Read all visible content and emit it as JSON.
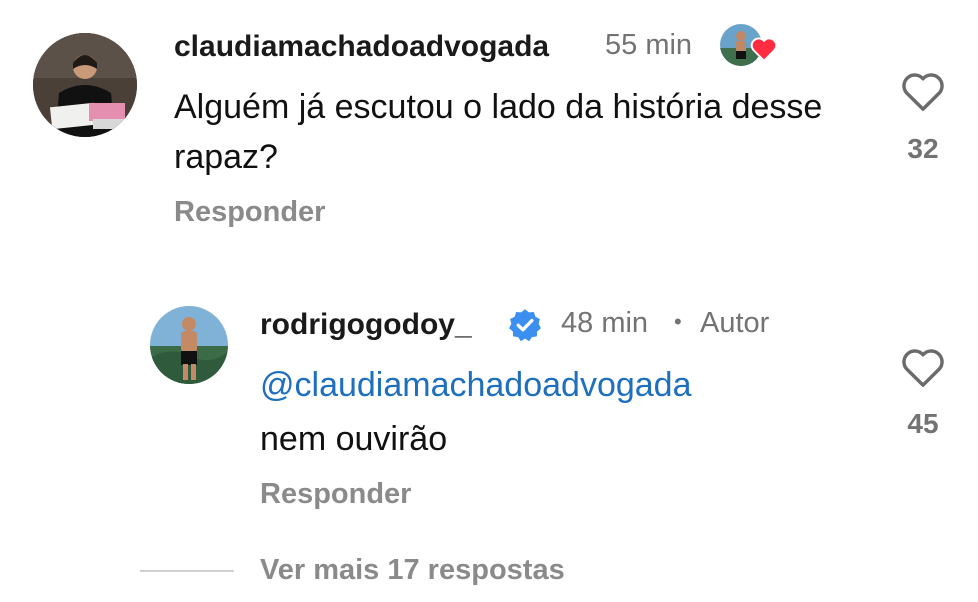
{
  "comment": {
    "username": "claudiamachadoadvogada",
    "time": "55 min",
    "text": "Alguém já escutou o lado da história desse rapaz?",
    "reply_label": "Responder",
    "likes": "32",
    "icons": {
      "avatar": "lawyer-avatar",
      "liked_by_author": "author-liked-heart-icon",
      "like": "heart-outline-icon"
    }
  },
  "reply": {
    "username": "rodrigogodoy_",
    "time": "48 min",
    "separator": "•",
    "author_badge": "Autor",
    "mention_symbol": "@",
    "mention": "claudiamachadoadvogada",
    "text": "nem ouvirão",
    "reply_label": "Responder",
    "likes": "45",
    "icons": {
      "verified": "verified-badge-icon",
      "like": "heart-outline-icon"
    },
    "colors": {
      "verified": "#3b8ff0",
      "mention": "#1f6fbf"
    }
  },
  "thread": {
    "view_more_label": "Ver mais 17 respostas"
  }
}
